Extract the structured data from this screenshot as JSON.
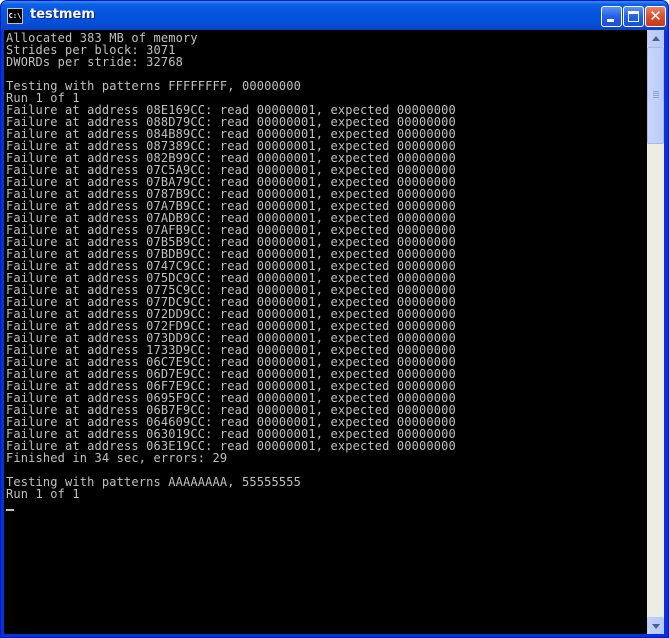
{
  "window": {
    "title": "testmem",
    "icon": "console-icon",
    "icon_text": "C:\\"
  },
  "titlebar_buttons": {
    "minimize": "minimize-icon",
    "maximize": "maximize-icon",
    "close": "close-icon",
    "close_glyph": "✕"
  },
  "console": {
    "lines": [
      "Allocated 383 MB of memory",
      "Strides per block: 3071",
      "DWORDs per stride: 32768",
      "",
      "Testing with patterns FFFFFFFF, 00000000",
      "Run 1 of 1",
      "Failure at address 08E169CC: read 00000001, expected 00000000",
      "Failure at address 088D79CC: read 00000001, expected 00000000",
      "Failure at address 084B89CC: read 00000001, expected 00000000",
      "Failure at address 087389CC: read 00000001, expected 00000000",
      "Failure at address 082B99CC: read 00000001, expected 00000000",
      "Failure at address 07C5A9CC: read 00000001, expected 00000000",
      "Failure at address 07BA79CC: read 00000001, expected 00000000",
      "Failure at address 0787B9CC: read 00000001, expected 00000000",
      "Failure at address 07A7B9CC: read 00000001, expected 00000000",
      "Failure at address 07ADB9CC: read 00000001, expected 00000000",
      "Failure at address 07AFB9CC: read 00000001, expected 00000000",
      "Failure at address 07B5B9CC: read 00000001, expected 00000000",
      "Failure at address 07BDB9CC: read 00000001, expected 00000000",
      "Failure at address 0747C9CC: read 00000001, expected 00000000",
      "Failure at address 075DC9CC: read 00000001, expected 00000000",
      "Failure at address 0775C9CC: read 00000001, expected 00000000",
      "Failure at address 077DC9CC: read 00000001, expected 00000000",
      "Failure at address 072DD9CC: read 00000001, expected 00000000",
      "Failure at address 072FD9CC: read 00000001, expected 00000000",
      "Failure at address 073DD9CC: read 00000001, expected 00000000",
      "Failure at address 1733D9CC: read 00000001, expected 00000000",
      "Failure at address 06C7E9CC: read 00000001, expected 00000000",
      "Failure at address 06D7E9CC: read 00000001, expected 00000000",
      "Failure at address 06F7E9CC: read 00000001, expected 00000000",
      "Failure at address 0695F9CC: read 00000001, expected 00000000",
      "Failure at address 06B7F9CC: read 00000001, expected 00000000",
      "Failure at address 064609CC: read 00000001, expected 00000000",
      "Failure at address 063019CC: read 00000001, expected 00000000",
      "Failure at address 063E19CC: read 00000001, expected 00000000",
      "Finished in 34 sec, errors: 29",
      "",
      "Testing with patterns AAAAAAAA, 55555555",
      "Run 1 of 1"
    ]
  },
  "colors": {
    "console_background": "#000000",
    "console_text": "#C0C0C0",
    "titlebar": "#0A5FE3",
    "window_frame": "#0831D9"
  }
}
